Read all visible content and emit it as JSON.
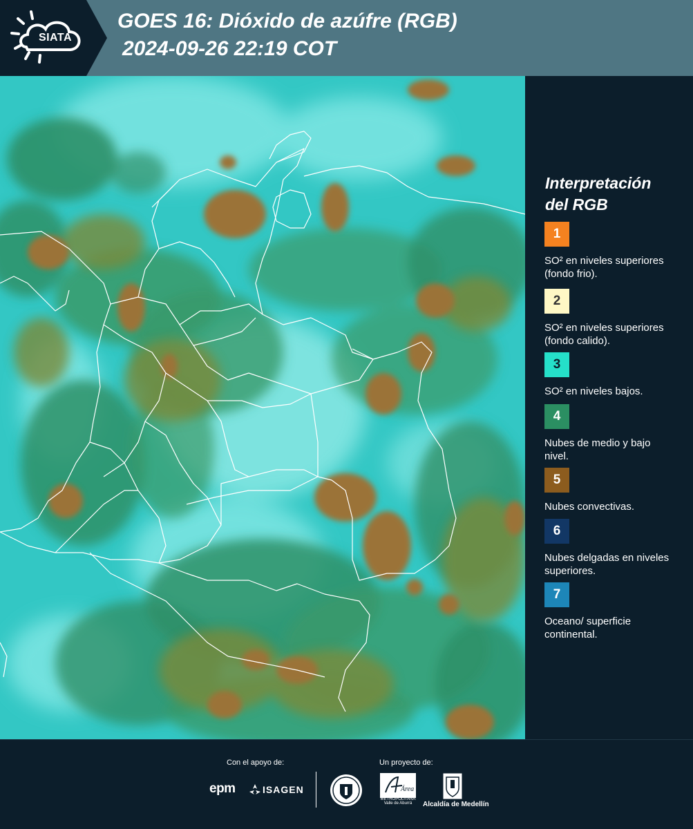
{
  "header": {
    "logo_text": "SIATA",
    "title_line1": "GOES 16: Dióxido de azúfre (RGB)",
    "title_line2": "2024-09-26 22:19 COT"
  },
  "legend": {
    "title_line1": "Interpretación",
    "title_line2": "del RGB",
    "items": [
      {
        "number": "1",
        "color": "#f58220",
        "text_color": "#ffffff",
        "label": "SO² en niveles superiores (fondo frio)."
      },
      {
        "number": "2",
        "color": "#fff8c5",
        "text_color": "#333333",
        "label": "SO² en niveles superiores (fondo calido)."
      },
      {
        "number": "3",
        "color": "#25e0c9",
        "text_color": "#0c1e2b",
        "label": "SO² en niveles bajos."
      },
      {
        "number": "4",
        "color": "#2b8f62",
        "text_color": "#ffffff",
        "label": "Nubes de medio y bajo nivel."
      },
      {
        "number": "5",
        "color": "#8c5c1e",
        "text_color": "#ffffff",
        "label": "Nubes convectivas."
      },
      {
        "number": "6",
        "color": "#123765",
        "text_color": "#ffffff",
        "label": "Nubes delgadas en niveles superiores."
      },
      {
        "number": "7",
        "color": "#1d86b8",
        "text_color": "#ffffff",
        "label": "Oceano/ superficie continental."
      }
    ]
  },
  "footer": {
    "support_label": "Con el apoyo de:",
    "project_label": "Un proyecto de:",
    "epm": "epm",
    "isagen": "ISAGEN",
    "area_name": "Área",
    "area_caption": "METROPOLITANA Valle de Aburrá",
    "alcaldia": "Alcaldía de Medellín"
  },
  "map": {
    "colors": {
      "background_cyan": "#33c7c4",
      "light_cyan": "#62dcd9",
      "green": "#2f9068",
      "olive": "#7a8a3a",
      "convective_brown": "#9b7338",
      "border_white": "#ffffff"
    }
  }
}
